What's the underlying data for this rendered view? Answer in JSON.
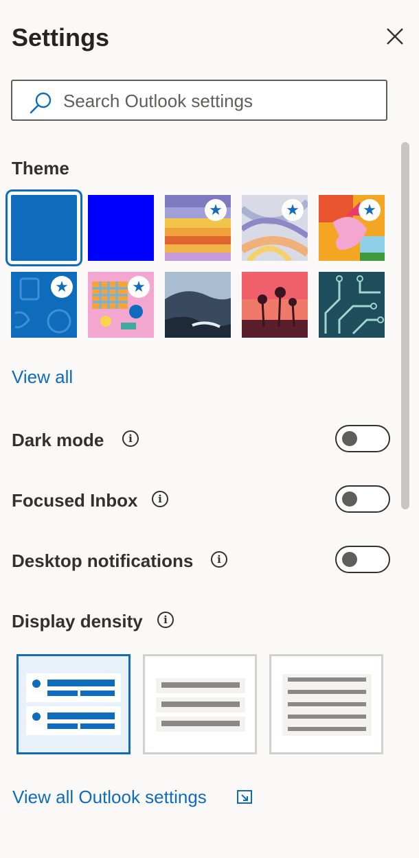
{
  "header": {
    "title": "Settings",
    "close_icon": "close-icon"
  },
  "search": {
    "placeholder": "Search Outlook settings",
    "value": "",
    "icon": "search-icon"
  },
  "theme": {
    "label": "Theme",
    "selected_index": 0,
    "tiles": [
      {
        "name": "solid-blue",
        "premium": false
      },
      {
        "name": "bright-blue",
        "premium": false
      },
      {
        "name": "sunset-stripes",
        "premium": true
      },
      {
        "name": "ribbons",
        "premium": true
      },
      {
        "name": "dragon",
        "premium": true
      },
      {
        "name": "sports-blue",
        "premium": true
      },
      {
        "name": "picnic",
        "premium": true
      },
      {
        "name": "mountain",
        "premium": false
      },
      {
        "name": "palms",
        "premium": false
      },
      {
        "name": "circuit",
        "premium": false
      }
    ],
    "view_all_label": "View all"
  },
  "toggles": {
    "dark_mode": {
      "label": "Dark mode",
      "on": false
    },
    "focused_inbox": {
      "label": "Focused Inbox",
      "on": false
    },
    "desktop_notifications": {
      "label": "Desktop notifications",
      "on": false
    }
  },
  "display_density": {
    "label": "Display density",
    "options": [
      "Full",
      "Medium",
      "Compact"
    ],
    "selected_index": 0
  },
  "footer": {
    "view_all_settings_label": "View all Outlook settings",
    "icon": "open-in-new-window-icon"
  },
  "colors": {
    "accent": "#0f6cbd",
    "background": "#faf9f8",
    "text": "#323130"
  }
}
